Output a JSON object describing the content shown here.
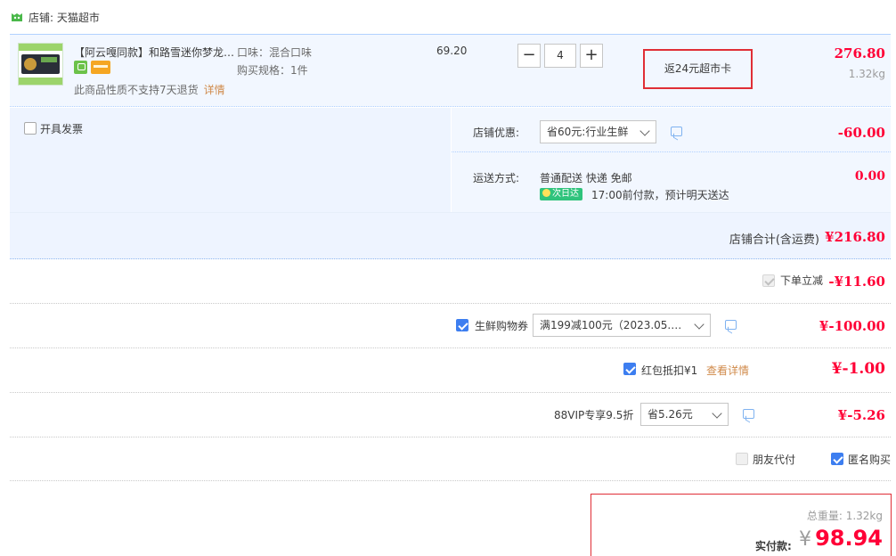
{
  "shop": {
    "label": "店铺: 天猫超市",
    "icon": "tmall-cat-icon"
  },
  "item": {
    "title": "【阿云嘎同款】和路雪迷你梦龙…",
    "sku_flavor": "口味：混合口味",
    "sku_spec": "购买规格：1件",
    "no_return_note": "此商品性质不支持7天退货",
    "detail_link": "详情",
    "unit_price": "69.20",
    "quantity": "4",
    "minus_label": "−",
    "plus_label": "+",
    "rebate": "返24元超市卡",
    "subtotal": "276.80",
    "weight": "1.32kg"
  },
  "invoice": {
    "label": "开具发票",
    "checked": false
  },
  "shop_discount": {
    "label": "店铺优惠:",
    "selected": "省60元:行业生鲜",
    "amount": "-60.00"
  },
  "shipping": {
    "label": "运送方式:",
    "method": "普通配送 快递 免邮",
    "badge": "次日达",
    "note": "17:00前付款，预计明天送达",
    "amount": "0.00"
  },
  "shop_total": {
    "label": "店铺合计(含运费)",
    "amount": "¥216.80"
  },
  "promos": {
    "instant": {
      "label": "下单立减",
      "amount": "-¥11.60",
      "checked": true,
      "disabled": true
    },
    "coupon": {
      "label": "生鲜购物券",
      "selected": "满199减100元（2023.05.…",
      "amount": "¥-100.00",
      "checked": true
    },
    "red_packet": {
      "label": "红包抵扣¥1",
      "detail_link": "查看详情",
      "amount": "¥-1.00",
      "checked": true
    },
    "vip": {
      "label": "88VIP专享9.5折",
      "selected": "省5.26元",
      "amount": "¥-5.26"
    },
    "friend_pay": {
      "label": "朋友代付",
      "checked": false
    },
    "anonymous": {
      "label": "匿名购买",
      "checked": true
    }
  },
  "summary": {
    "total_weight": "总重量: 1.32kg",
    "pay_label": "实付款:",
    "currency": "¥",
    "amount": "98.94"
  },
  "colors": {
    "price_red": "#ff0036",
    "accent_blue": "#3d7ef0",
    "highlight_border": "#e02e36",
    "row_bg": "#f2f7ff"
  }
}
